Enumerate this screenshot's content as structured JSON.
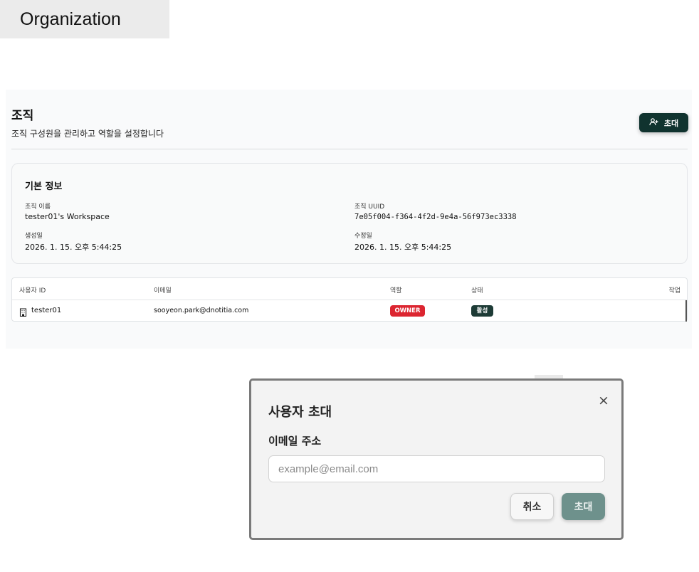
{
  "tab": {
    "label": "Organization"
  },
  "header": {
    "title": "조직",
    "subtitle": "조직 구성원을 관리하고 역할을 설정합니다",
    "invite_label": "초대"
  },
  "basic_info": {
    "title": "기본 정보",
    "org_name_label": "조직 이름",
    "org_name_value": "tester01's Workspace",
    "uuid_label": "조직 UUID",
    "uuid_value": "7e05f004-f364-4f2d-9e4a-56f973ec3338",
    "created_label": "생성일",
    "created_value": "2026. 1. 15. 오후 5:44:25",
    "updated_label": "수정일",
    "updated_value": "2026. 1. 15. 오후 5:44:25"
  },
  "members_table": {
    "columns": [
      "사용자 ID",
      "이메일",
      "역할",
      "상태",
      "작업"
    ],
    "rows": [
      {
        "user_id": "tester01",
        "email": "sooyeon.park@dnotitia.com",
        "role": "OWNER",
        "status": "활성"
      }
    ]
  },
  "invite_modal": {
    "title": "사용자 초대",
    "close": "×",
    "email_label": "이메일 주소",
    "email_value": "",
    "email_placeholder": "example@email.com",
    "cancel_label": "취소",
    "submit_label": "초대"
  },
  "colors": {
    "accent": "#10332f",
    "owner_badge": "#dc2530",
    "status_badge": "#1d3b36",
    "submit_button": "#6e918c"
  }
}
